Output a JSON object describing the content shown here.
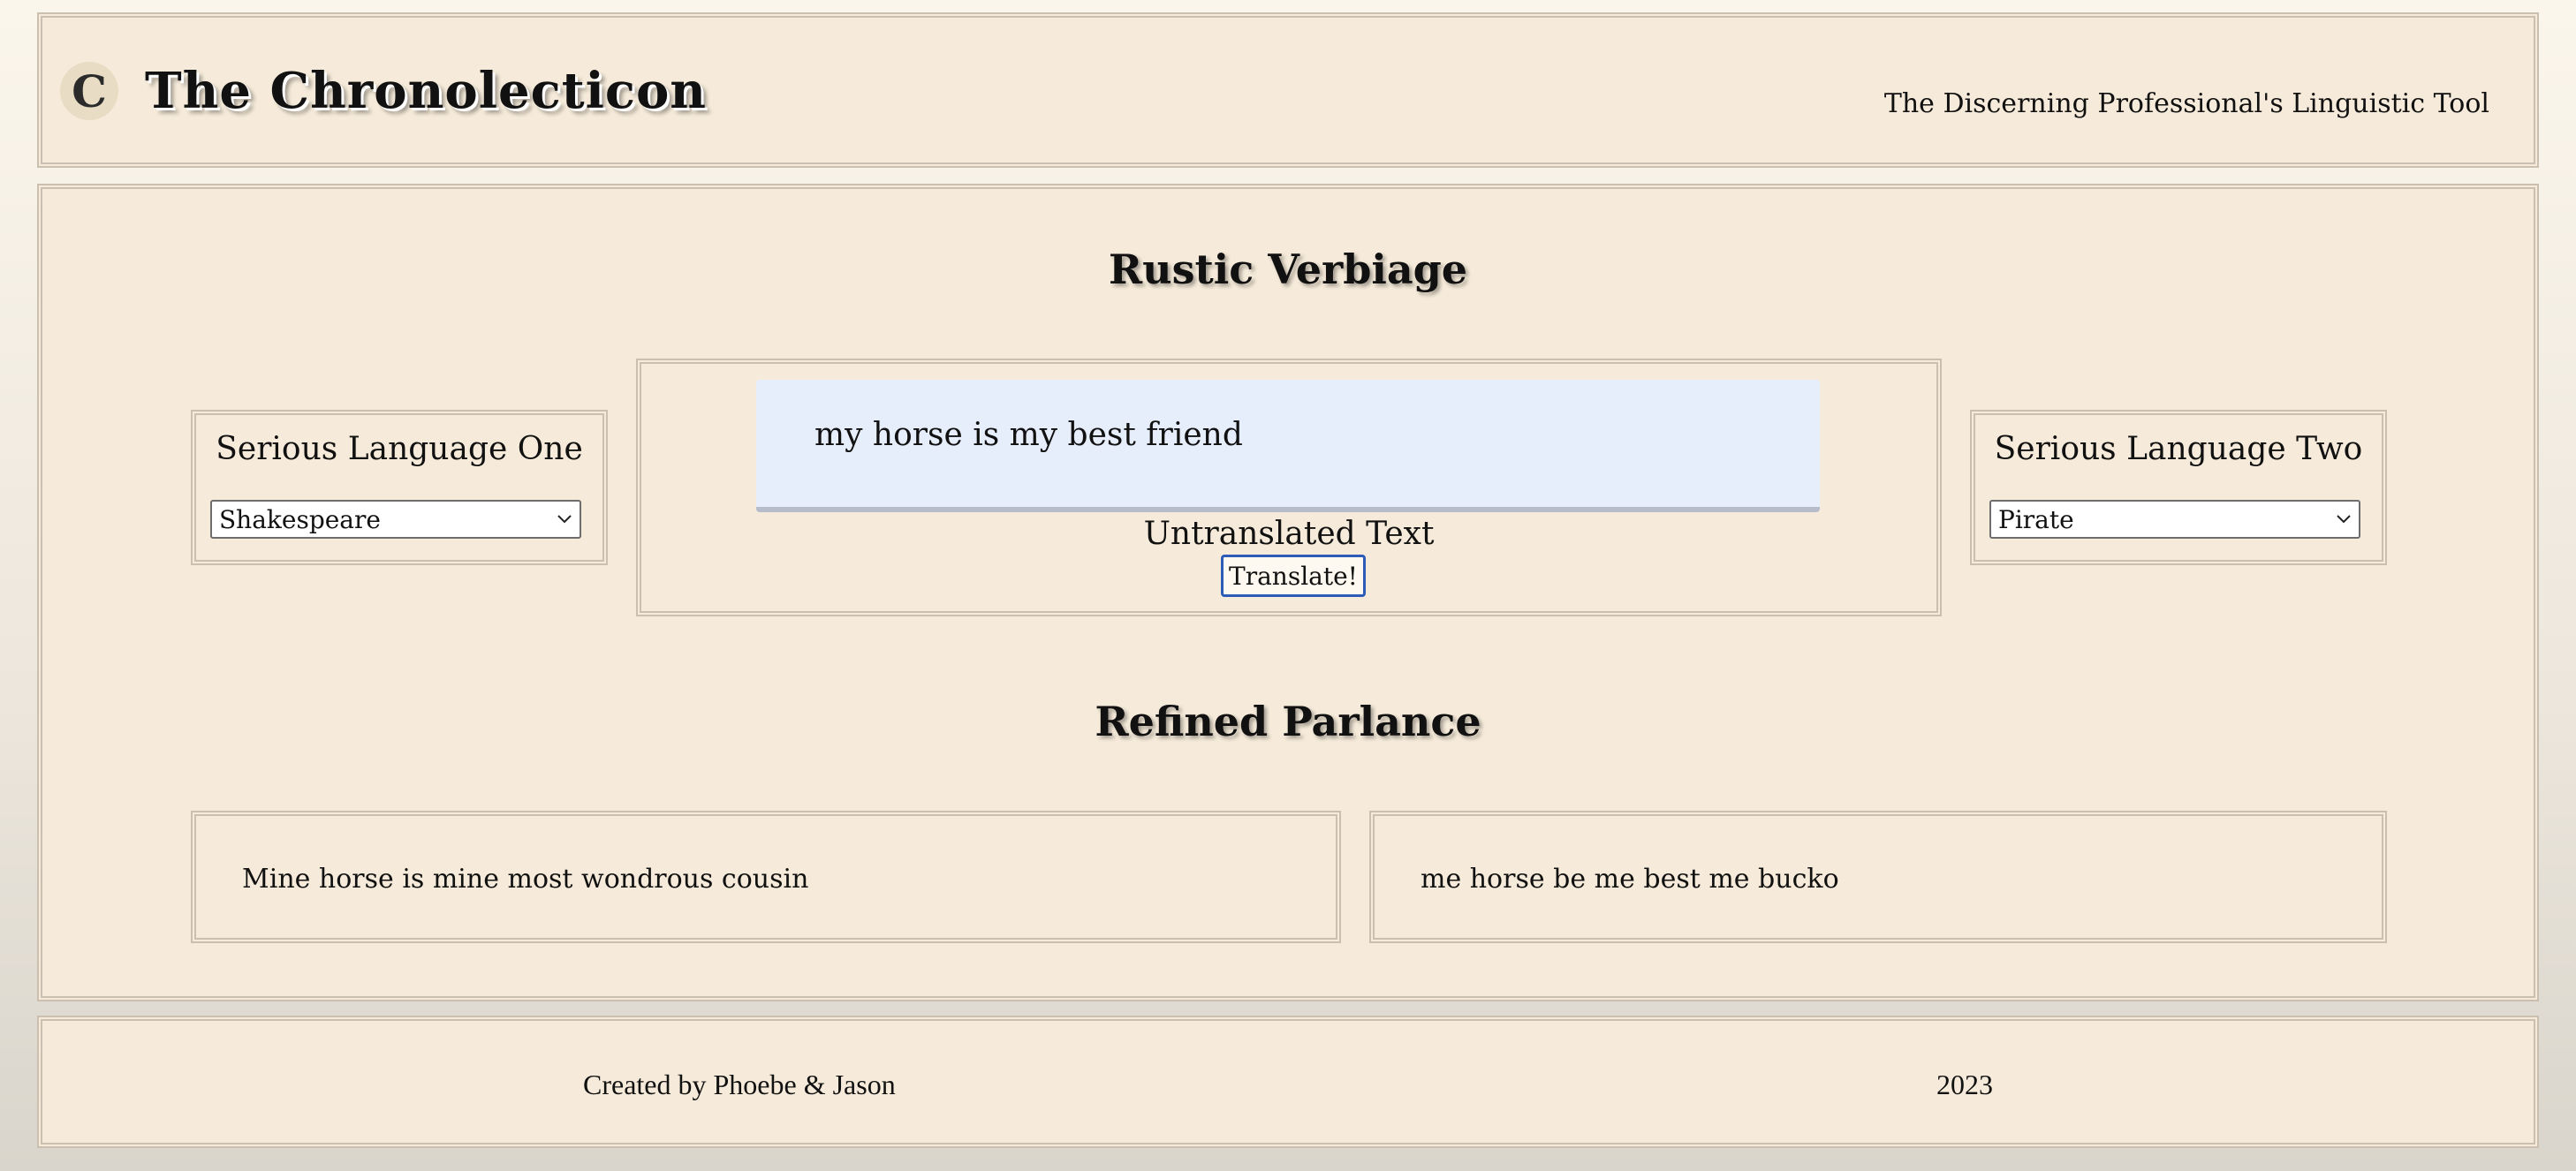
{
  "header": {
    "logo_glyph": "C",
    "title": "The Chronolecticon",
    "tagline": "The Discerning Professional's Linguistic Tool"
  },
  "main": {
    "input_heading": "Rustic Verbiage",
    "language_one": {
      "title": "Serious Language One",
      "selected": "Shakespeare"
    },
    "language_two": {
      "title": "Serious Language Two",
      "selected": "Pirate"
    },
    "input": {
      "value": "my horse is my best friend",
      "label": "Untranslated Text",
      "button_label": "Translate!"
    },
    "output_heading": "Refined Parlance",
    "output_one": "Mine horse is mine most wondrous cousin",
    "output_two": "me horse be me best me bucko"
  },
  "footer": {
    "credit": "Created by Phoebe & Jason",
    "year": "2023"
  },
  "colors": {
    "panel_background": "#f6ebda",
    "panel_border": "#cbbfb0",
    "input_background": "#e6edfb",
    "button_border": "#2c5cb8"
  },
  "icons": {
    "logo": "gothic-c-logo-icon",
    "select_arrow": "chevron-down-icon"
  }
}
